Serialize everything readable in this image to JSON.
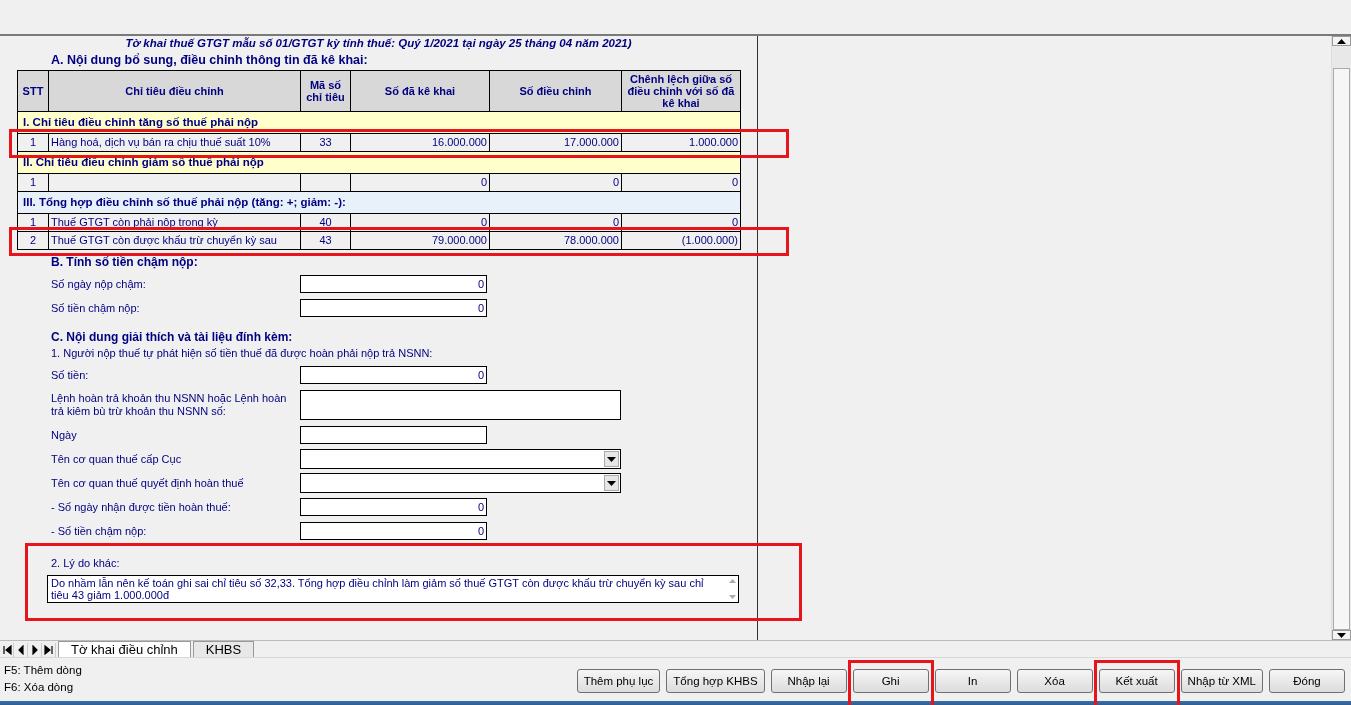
{
  "form_title": "Tờ khai thuế GTGT mẫu số 01/GTGT kỳ tính thuế: Quý 1/2021 tại ngày 25 tháng 04 năm 2021)",
  "section_a": {
    "heading": "A. Nội dung bổ sung, điều chỉnh thông tin đã kê khai:",
    "columns": [
      "STT",
      "Chỉ tiêu điều chỉnh",
      "Mã số chỉ tiêu",
      "Số đã kê khai",
      "Số điều chỉnh",
      "Chênh lệch giữa số điều chỉnh với số đã kê khai"
    ],
    "groups": [
      {
        "title": "I. Chỉ tiêu điều chỉnh tăng số thuế phải nộp",
        "color": "#ffffcc",
        "rows": [
          {
            "stt": "1",
            "item": "Hàng hoá, dịch vụ bán ra chịu thuế suất 10%",
            "code": "33",
            "declared": "16.000.000",
            "adjusted": "17.000.000",
            "difference": "1.000.000",
            "highlighted": true
          }
        ]
      },
      {
        "title": "II. Chỉ tiêu điều chỉnh giảm số thuế phải nộp",
        "color": "#ffffcc",
        "rows": [
          {
            "stt": "1",
            "item": "",
            "code": "",
            "declared": "0",
            "adjusted": "0",
            "difference": "0",
            "highlighted": false
          }
        ]
      },
      {
        "title": "III. Tổng hợp điều chỉnh số thuế phải nộp (tăng: +; giảm: -):",
        "color": "#e8f1fa",
        "rows": [
          {
            "stt": "1",
            "item": "Thuế GTGT còn phải nộp trong kỳ",
            "code": "40",
            "declared": "0",
            "adjusted": "0",
            "difference": "0",
            "highlighted": false
          },
          {
            "stt": "2",
            "item": "Thuế GTGT còn được khấu trừ chuyển kỳ sau",
            "code": "43",
            "declared": "79.000.000",
            "adjusted": "78.000.000",
            "difference": "(1.000.000)",
            "highlighted": true
          }
        ]
      }
    ]
  },
  "section_b": {
    "heading": "B. Tính số tiền chậm nộp:",
    "fields": [
      {
        "kind": "number",
        "label": "Số ngày nộp chậm:",
        "value": "0"
      },
      {
        "kind": "number",
        "label": "Số tiền chậm nộp:",
        "value": "0"
      }
    ]
  },
  "section_c": {
    "heading": "C. Nội dung giải thích và tài liệu đính kèm:",
    "subheading": "1. Người nộp thuế tự phát hiện số tiền thuế đã được hoàn phải nộp trả NSNN:",
    "fields": [
      {
        "kind": "number",
        "label": "Số tiền:",
        "value": "0"
      },
      {
        "kind": "wide",
        "label": "Lệnh hoàn trả khoản thu NSNN hoặc Lệnh hoàn trả kiêm bù trừ khoản thu NSNN số:"
      },
      {
        "kind": "text",
        "label": "Ngày"
      },
      {
        "kind": "dropdown",
        "label": "Tên cơ quan thuế cấp Cục"
      },
      {
        "kind": "dropdown",
        "label": "Tên cơ quan thuế quyết định hoàn thuế"
      },
      {
        "kind": "number",
        "label": "- Số ngày nhận được tiền hoàn thuế:",
        "value": "0"
      },
      {
        "kind": "number",
        "label": "- Số tiền chậm nộp:",
        "value": "0"
      }
    ],
    "other_reason": {
      "label": "2. Lý do khác:",
      "value": "Do nhầm lẫn nên kế toán ghi sai chỉ tiêu số 32,33. Tổng hợp điều chỉnh làm giảm số thuế GTGT còn được khấu trừ chuyển kỳ sau chỉ tiêu 43 giảm 1.000.000đ",
      "highlighted": true
    }
  },
  "sheet_tabs": [
    {
      "label": "Tờ khai điều chỉnh",
      "selected": true
    },
    {
      "label": "KHBS",
      "selected": false
    }
  ],
  "shortcuts": [
    "F5: Thêm dòng",
    "F6: Xóa dòng"
  ],
  "buttons": [
    {
      "label": "Thêm phụ lục",
      "highlighted": false
    },
    {
      "label": "Tổng hợp KHBS",
      "highlighted": false
    },
    {
      "label": "Nhập lại",
      "highlighted": false
    },
    {
      "label": "Ghi",
      "highlighted": true
    },
    {
      "label": "In",
      "highlighted": false
    },
    {
      "label": "Xóa",
      "highlighted": false
    },
    {
      "label": "Kết xuất",
      "highlighted": true
    },
    {
      "label": "Nhập từ XML",
      "highlighted": false
    },
    {
      "label": "Đóng",
      "highlighted": false
    }
  ]
}
